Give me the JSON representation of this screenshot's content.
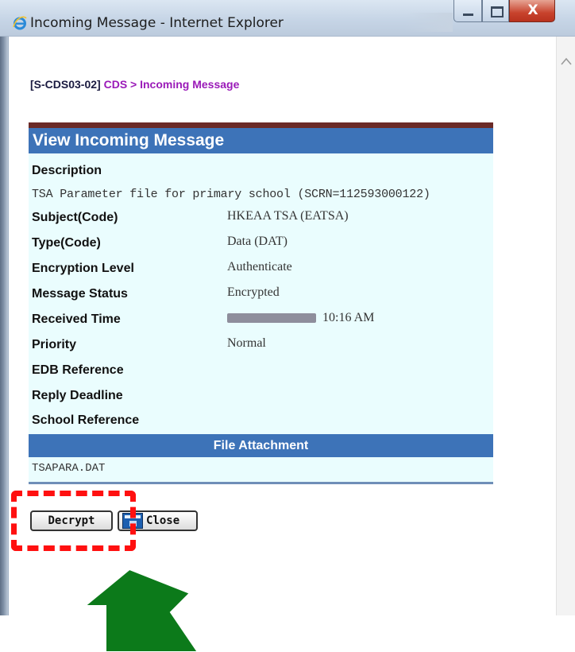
{
  "window": {
    "title": "Incoming Message - Internet Explorer",
    "close_glyph": "X"
  },
  "breadcrumb": {
    "code": "[S-CDS03-02]",
    "path": "CDS > Incoming Message"
  },
  "panel": {
    "title": "View Incoming Message",
    "description_label": "Description",
    "description_value": "TSA Parameter file for primary school (SCRN=112593000122)",
    "fields": [
      {
        "label": "Subject(Code)",
        "value": "HKEAA TSA (EATSA)"
      },
      {
        "label": "Type(Code)",
        "value": "Data (DAT)"
      },
      {
        "label": "Encryption Level",
        "value": "Authenticate"
      },
      {
        "label": "Message Status",
        "value": "Encrypted"
      },
      {
        "label": "Received Time",
        "value": "10:16 AM"
      },
      {
        "label": "Priority",
        "value": "Normal"
      },
      {
        "label": "EDB Reference",
        "value": ""
      },
      {
        "label": "Reply Deadline",
        "value": ""
      },
      {
        "label": "School Reference",
        "value": ""
      }
    ],
    "attachment_header": "File Attachment",
    "attachment_file": "TSAPARA.DAT"
  },
  "buttons": {
    "decrypt": "Decrypt",
    "close": "Close"
  },
  "colors": {
    "header_blue": "#3d73b8",
    "panel_bg": "#eafdfe",
    "breadcrumb_purple": "#9a1ab8",
    "highlight_red": "#ff1010",
    "arrow_green": "#0c7a1a"
  },
  "icons": {
    "browser": "internet-explorer-icon",
    "close_button": "window-close-icon"
  }
}
